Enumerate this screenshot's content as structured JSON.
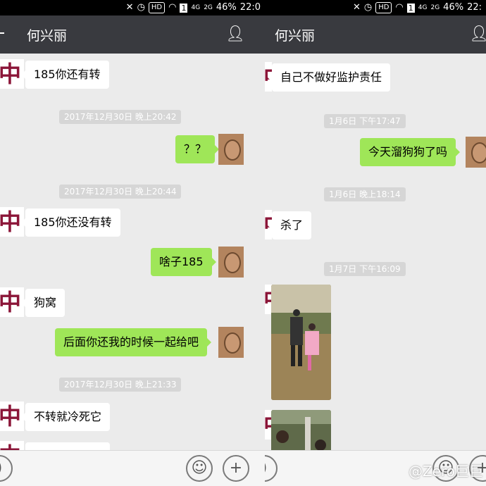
{
  "status": {
    "left": {
      "hd": "HD",
      "sim": "1",
      "network": "4G",
      "signal2": "2G",
      "battery": "46%",
      "time": "22:0"
    },
    "right": {
      "hd": "HD",
      "sim": "1",
      "network": "4G",
      "signal2": "2G",
      "battery": "46%",
      "time": "22:"
    }
  },
  "contact_name": "何兴丽",
  "left": {
    "messages": [
      {
        "type": "in",
        "text": "185你还有转"
      },
      {
        "type": "time",
        "text": "2017年12月30日 晚上20:42"
      },
      {
        "type": "out",
        "text": "？？"
      },
      {
        "type": "time",
        "text": "2017年12月30日 晚上20:44"
      },
      {
        "type": "in",
        "text": "185你还没有转"
      },
      {
        "type": "out",
        "text": "啥子185"
      },
      {
        "type": "in",
        "text": "狗窝"
      },
      {
        "type": "out",
        "text": "后面你还我的时候一起给吧"
      },
      {
        "type": "time",
        "text": "2017年12月30日 晚上21:33"
      },
      {
        "type": "in",
        "text": "不转就冷死它"
      }
    ]
  },
  "right": {
    "messages": [
      {
        "type": "in",
        "text": "自己不做好监护责任"
      },
      {
        "type": "time",
        "text": "1月6日 下午17:47"
      },
      {
        "type": "out",
        "text": "今天溜狗狗了吗"
      },
      {
        "type": "time",
        "text": "1月6日 晚上18:14"
      },
      {
        "type": "in",
        "text": "杀了"
      },
      {
        "type": "time",
        "text": "1月7日 下午16:09"
      }
    ]
  },
  "icons": {
    "back": "back-arrow-icon",
    "contact": "contact-info-icon",
    "voice": "voice-icon",
    "emoji": "emoji-icon",
    "plus": "plus-icon",
    "avatar_in": "logo-avatar-icon"
  },
  "avatar_logo_glyph": "中",
  "watermark": "@Zero巨巨",
  "colors": {
    "out_bubble": "#9fe658",
    "titlebar": "#393a3f",
    "background": "#ebebeb"
  }
}
